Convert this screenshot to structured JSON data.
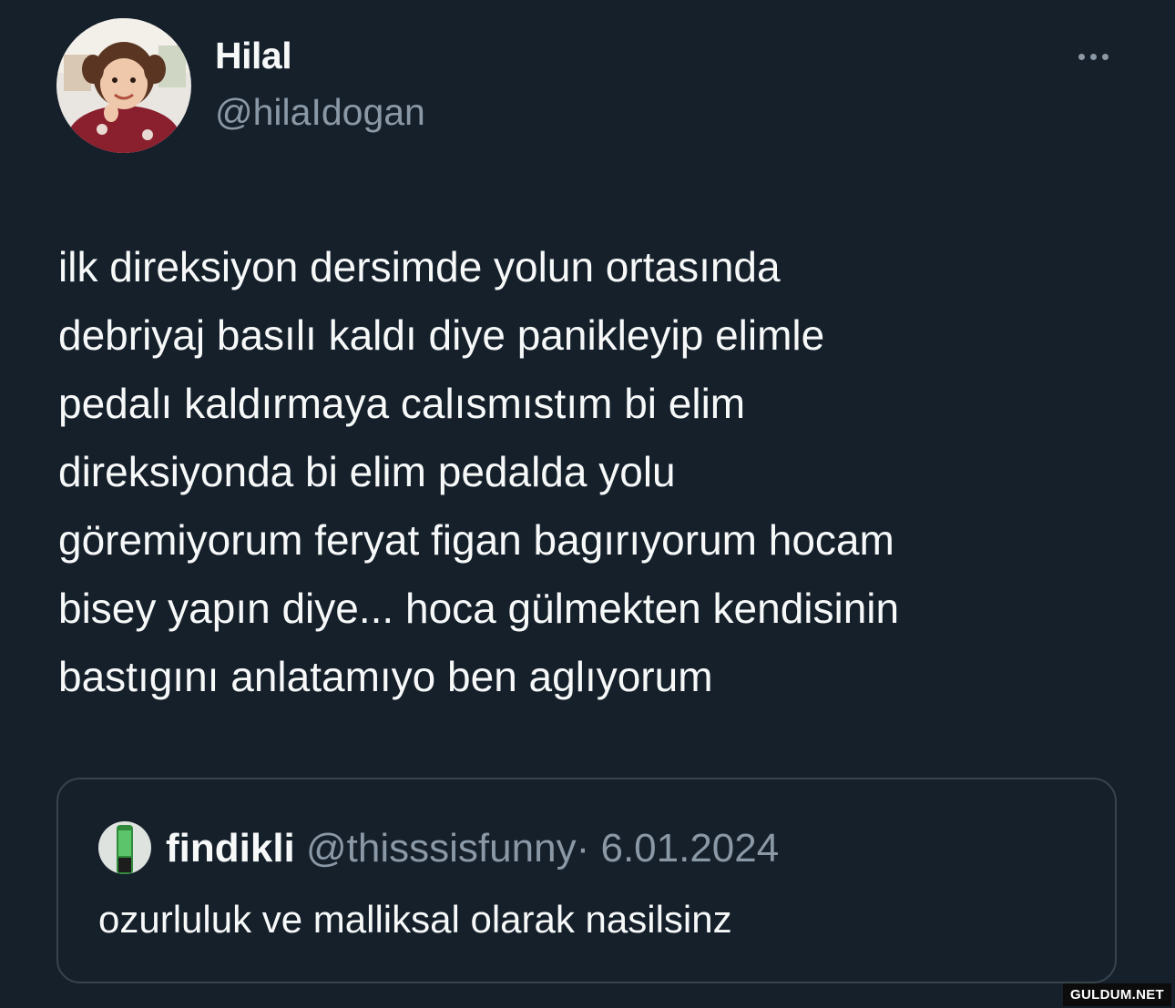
{
  "author": {
    "display_name": "Hilal",
    "handle": "@hilaIdogan"
  },
  "more_icon": "more-dots-icon",
  "tweet": {
    "lines": [
      "ilk direksiyon dersimde yolun ortasında",
      "debriyaj basılı kaldı diye panikleyip elimle",
      "pedalı kaldırmaya calısmıstım bi elim",
      "direksiyonda bi elim pedalda yolu",
      "göremiyorum feryat figan bagırıyorum hocam",
      "bisey yapın diye... hoca gülmekten kendisinin",
      "bastıgını anlatamıyo ben aglıyorum"
    ]
  },
  "quote": {
    "display_name": "findikli",
    "handle": "@thisssisfunny",
    "separator": "·",
    "date": "6.01.2024",
    "text": "ozurluluk ve malliksal olarak nasilsinz"
  },
  "watermark": "GULDUM.NET",
  "colors": {
    "background": "#15202b",
    "text_primary": "#f7f9f9",
    "text_secondary": "#8b98a5",
    "border": "#38444d"
  }
}
